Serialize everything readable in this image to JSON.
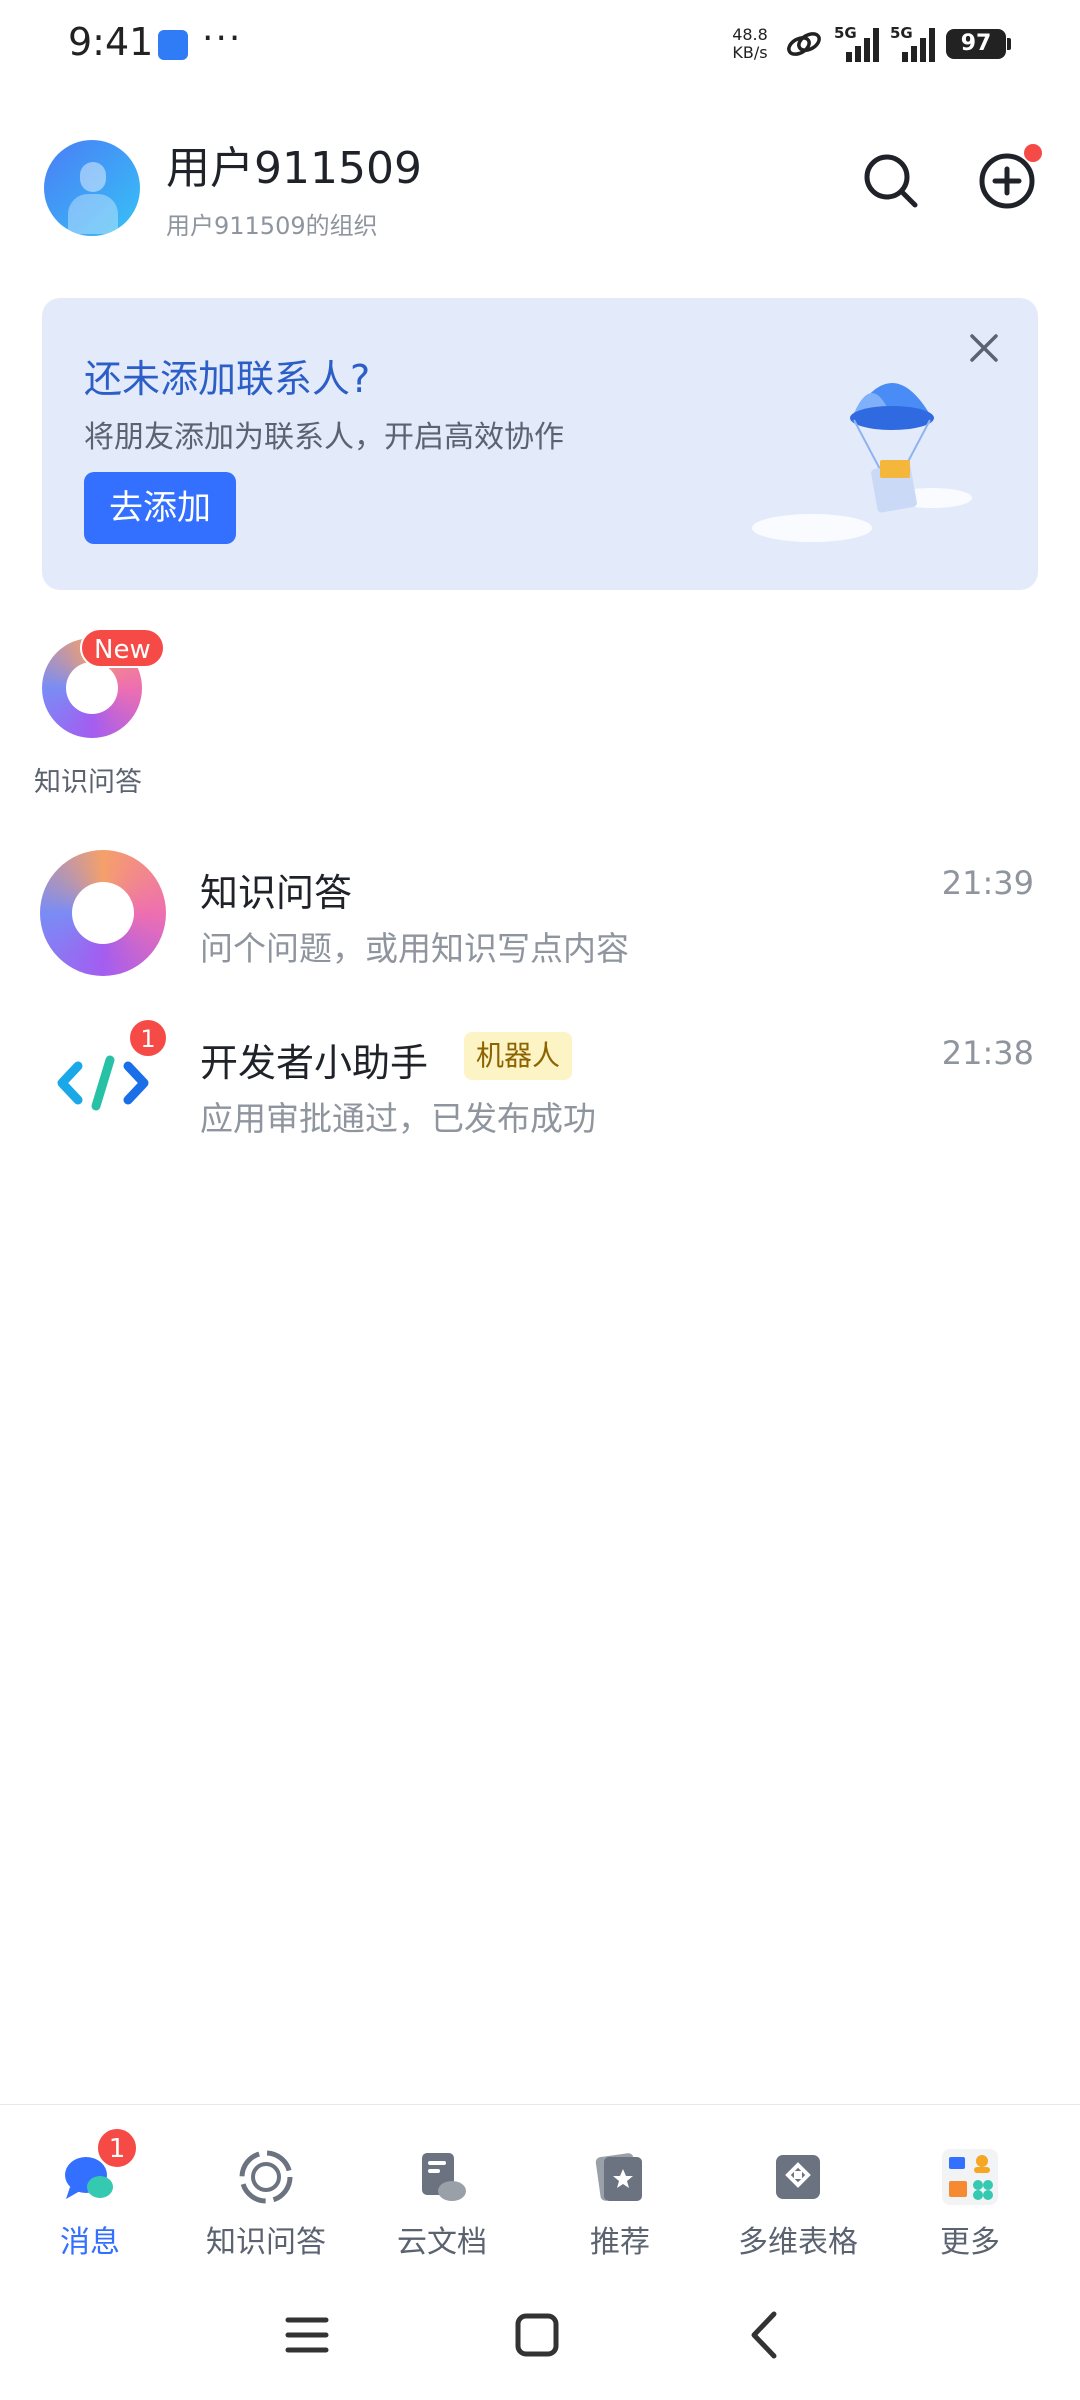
{
  "status_bar": {
    "time": "9:41",
    "dots": "···",
    "speed_value": "48.8",
    "speed_unit": "KB/s",
    "network1": "5G",
    "network2": "5G",
    "battery": "97"
  },
  "header": {
    "user_name": "用户911509",
    "org_name": "用户911509的组织"
  },
  "banner": {
    "title": "还未添加联系人?",
    "subtitle": "将朋友添加为联系人，开启高效协作",
    "button_label": "去添加"
  },
  "quick_access": {
    "label": "知识问答",
    "badge": "New"
  },
  "chats": [
    {
      "title": "知识问答",
      "preview": "问个问题，或用知识写点内容",
      "time": "21:39"
    },
    {
      "title": "开发者小助手",
      "tag": "机器人",
      "preview": "应用审批通过，已发布成功",
      "time": "21:38",
      "unread": "1"
    }
  ],
  "tabs": [
    {
      "label": "消息",
      "badge": "1",
      "active": true
    },
    {
      "label": "知识问答"
    },
    {
      "label": "云文档"
    },
    {
      "label": "推荐"
    },
    {
      "label": "多维表格"
    },
    {
      "label": "更多"
    }
  ],
  "colors": {
    "accent": "#3370ff",
    "badge": "#f54a45",
    "banner_bg": "#e3ebfb",
    "tag_bg": "#fdf4c5"
  }
}
